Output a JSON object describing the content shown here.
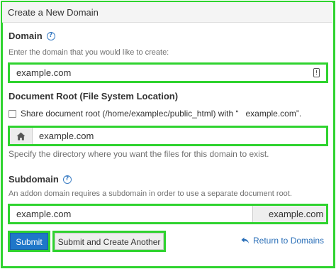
{
  "header": {
    "title": "Create a New Domain"
  },
  "domain": {
    "label": "Domain",
    "hint": "Enter the domain that you would like to create:",
    "value": "example.com"
  },
  "document_root": {
    "label": "Document Root (File System Location)",
    "share_label": "Share document root (/home/examplec/public_html) with “",
    "share_domain": "example.com”.",
    "value": "example.com",
    "hint": "Specify the directory where you want the files for this domain to exist."
  },
  "subdomain": {
    "label": "Subdomain",
    "hint": "An addon domain requires a subdomain in order to use a separate document root.",
    "value": "example.com",
    "suffix": "example.com"
  },
  "actions": {
    "submit_label": "Submit",
    "submit_another_label": "Submit and Create Another",
    "return_label": "Return to Domains"
  },
  "colors": {
    "highlight": "#2fd32f",
    "primary_button": "#1f77c9",
    "link": "#2a6fb8"
  },
  "icons": {
    "help": "help-circle-icon",
    "alert": "alert-icon",
    "home": "home-icon",
    "return": "undo-arrow-icon"
  }
}
